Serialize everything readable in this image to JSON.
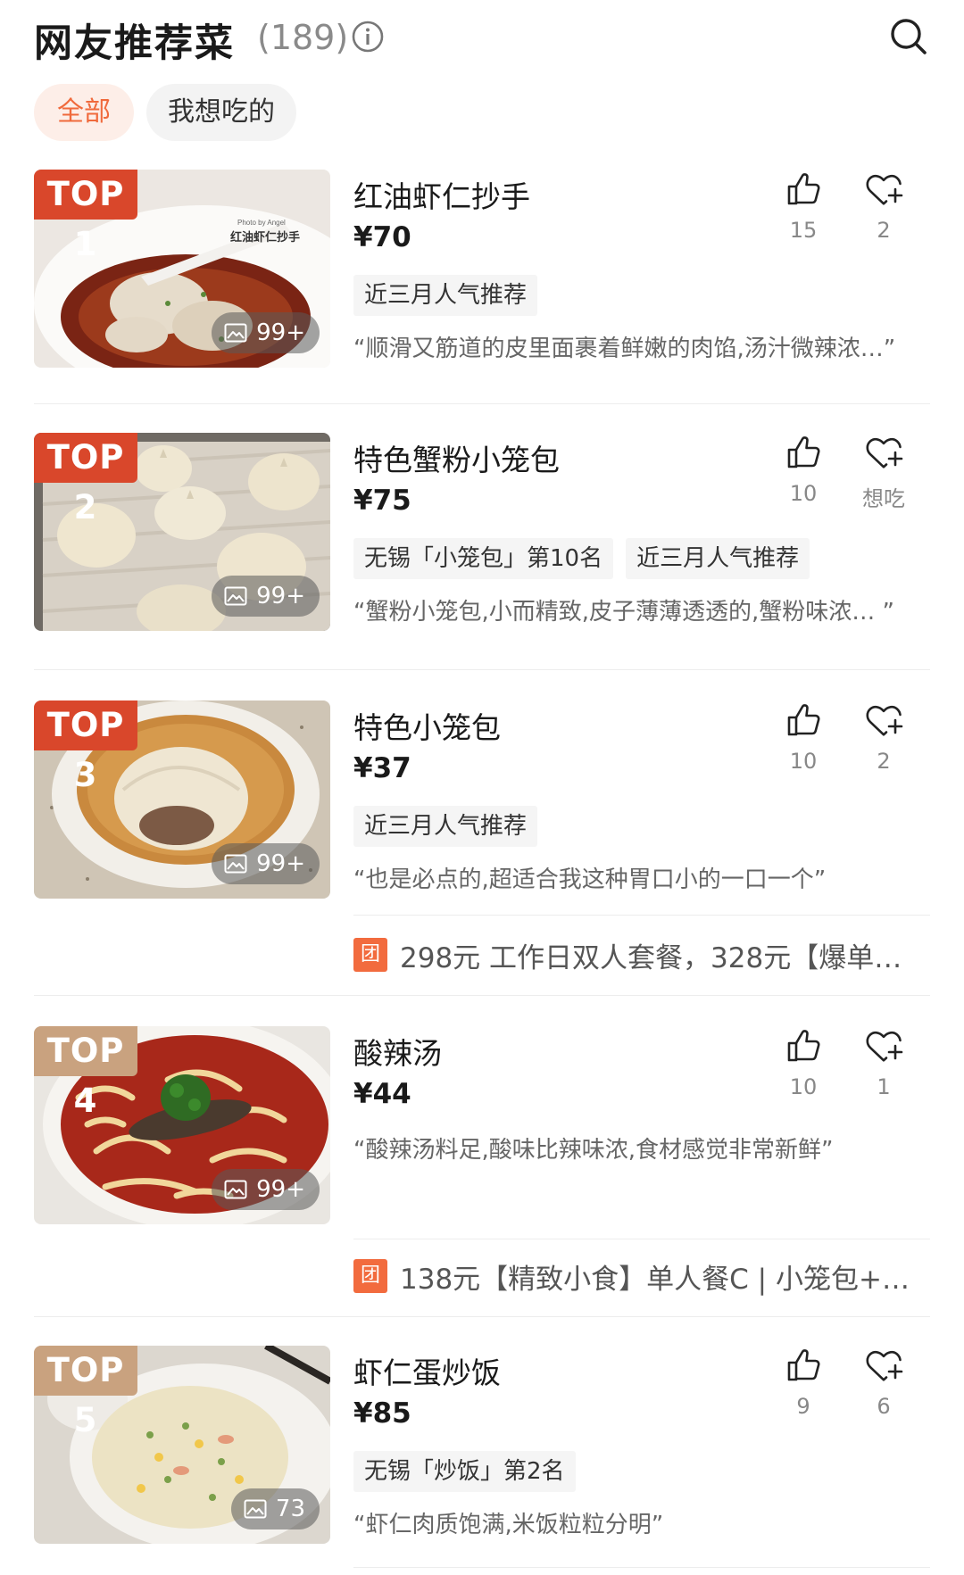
{
  "header": {
    "title": "网友推荐菜",
    "count": "(189)"
  },
  "filters": [
    {
      "label": "全部"
    },
    {
      "label": "我想吃的"
    }
  ],
  "colors": {
    "accent": "#f06a3c",
    "rank_hot": "#d9472b",
    "rank_warm": "#c9a27f"
  },
  "dishes": [
    {
      "rank": "TOP 1",
      "photos": "99+",
      "name": "红油虾仁抄手",
      "price": "¥70",
      "tags": [
        "近三月人气推荐"
      ],
      "quote": "“顺滑又筋道的皮里面裹着鲜嫩的肉馅,汤汁微辣浓…”",
      "likes": "15",
      "wants": "2",
      "photo_caption": "红油虾仁抄手",
      "photo_credit": "Photo by Angel"
    },
    {
      "rank": "TOP 2",
      "photos": "99+",
      "name": "特色蟹粉小笼包",
      "price": "¥75",
      "tags": [
        "无锡「小笼包」第10名",
        "近三月人气推荐"
      ],
      "quote": "“蟹粉小笼包,小而精致,皮子薄薄透透的,蟹粉味浓… ”",
      "likes": "10",
      "wants": "想吃"
    },
    {
      "rank": "TOP 3",
      "photos": "99+",
      "name": "特色小笼包",
      "price": "¥37",
      "tags": [
        "近三月人气推荐"
      ],
      "quote": "“也是必点的,超适合我这种胃口小的一口一个”",
      "likes": "10",
      "wants": "2",
      "deal_badge": "团",
      "deal": "298元 工作日双人套餐，328元【爆单…"
    },
    {
      "rank": "TOP 4",
      "photos": "99+",
      "name": "酸辣汤",
      "price": "¥44",
      "tags": [],
      "quote": "“酸辣汤料足,酸味比辣味浓,食材感觉非常新鲜”",
      "likes": "10",
      "wants": "1",
      "deal_badge": "团",
      "deal": "138元【精致小食】单人餐C | 小笼包+…"
    },
    {
      "rank": "TOP 5",
      "photos": "73",
      "name": "虾仁蛋炒饭",
      "price": "¥85",
      "tags": [
        "无锡「炒饭」第2名"
      ],
      "quote": "“虾仁肉质饱满,米饭粒粒分明”",
      "likes": "9",
      "wants": "6"
    }
  ]
}
